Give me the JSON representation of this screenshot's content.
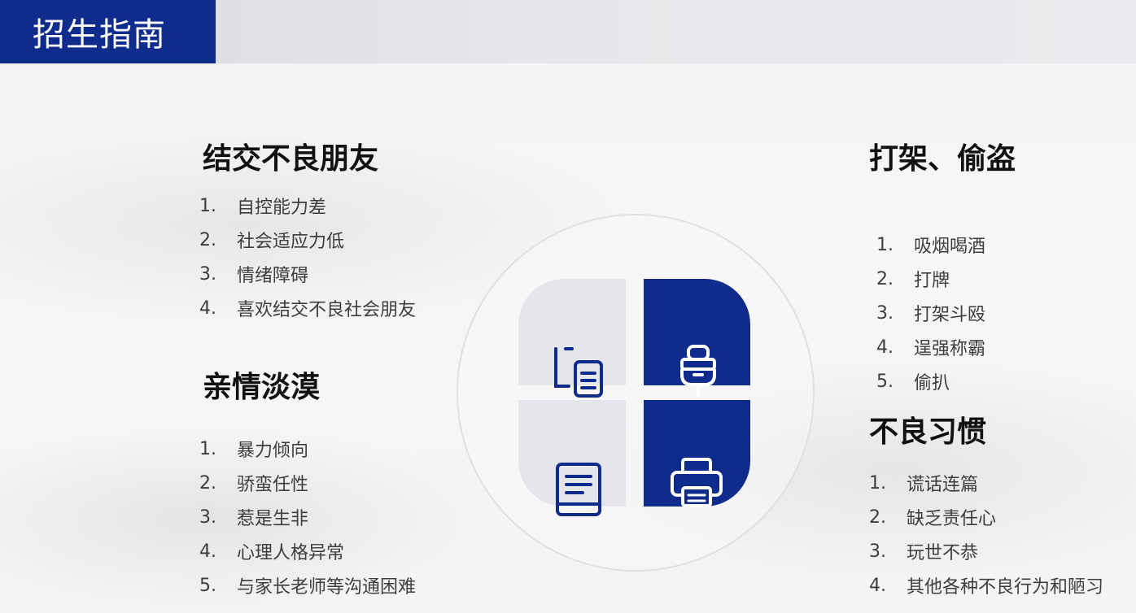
{
  "header": {
    "title": "招生指南"
  },
  "sections": {
    "friends": {
      "heading": "结交不良朋友",
      "items": [
        {
          "num": "1.",
          "text": "自控能力差"
        },
        {
          "num": "2.",
          "text": "社会适应力低"
        },
        {
          "num": "3.",
          "text": "情绪障碍"
        },
        {
          "num": "4.",
          "text": "喜欢结交不良社会朋友"
        }
      ]
    },
    "family": {
      "heading": "亲情淡漠",
      "items": [
        {
          "num": "1.",
          "text": "暴力倾向"
        },
        {
          "num": "2.",
          "text": "骄蛮任性"
        },
        {
          "num": "3.",
          "text": "惹是生非"
        },
        {
          "num": "4.",
          "text": "心理人格异常"
        },
        {
          "num": "5.",
          "text": "与家长老师等沟通困难"
        }
      ]
    },
    "fighting": {
      "heading": "打架、偷盗",
      "items": [
        {
          "num": "1.",
          "text": "吸烟喝酒"
        },
        {
          "num": "2.",
          "text": "打牌"
        },
        {
          "num": "3.",
          "text": "打架斗殴"
        },
        {
          "num": "4.",
          "text": "逞强称霸"
        },
        {
          "num": "5.",
          "text": "偷扒"
        }
      ]
    },
    "habits": {
      "heading": "不良习惯",
      "items": [
        {
          "num": "1.",
          "text": "谎话连篇"
        },
        {
          "num": "2.",
          "text": "缺乏责任心"
        },
        {
          "num": "3.",
          "text": "玩世不恭"
        },
        {
          "num": "4.",
          "text": "其他各种不良行为和陋习"
        }
      ]
    }
  },
  "icons": {
    "top_left": "copy-document-icon",
    "top_right": "plug-icon",
    "bottom_left": "book-icon",
    "bottom_right": "printer-icon"
  },
  "colors": {
    "brand_blue": "#0f2b8c",
    "tile_light": "#e4e6ec",
    "heading": "#111111",
    "body_text": "#3d3d3d"
  }
}
